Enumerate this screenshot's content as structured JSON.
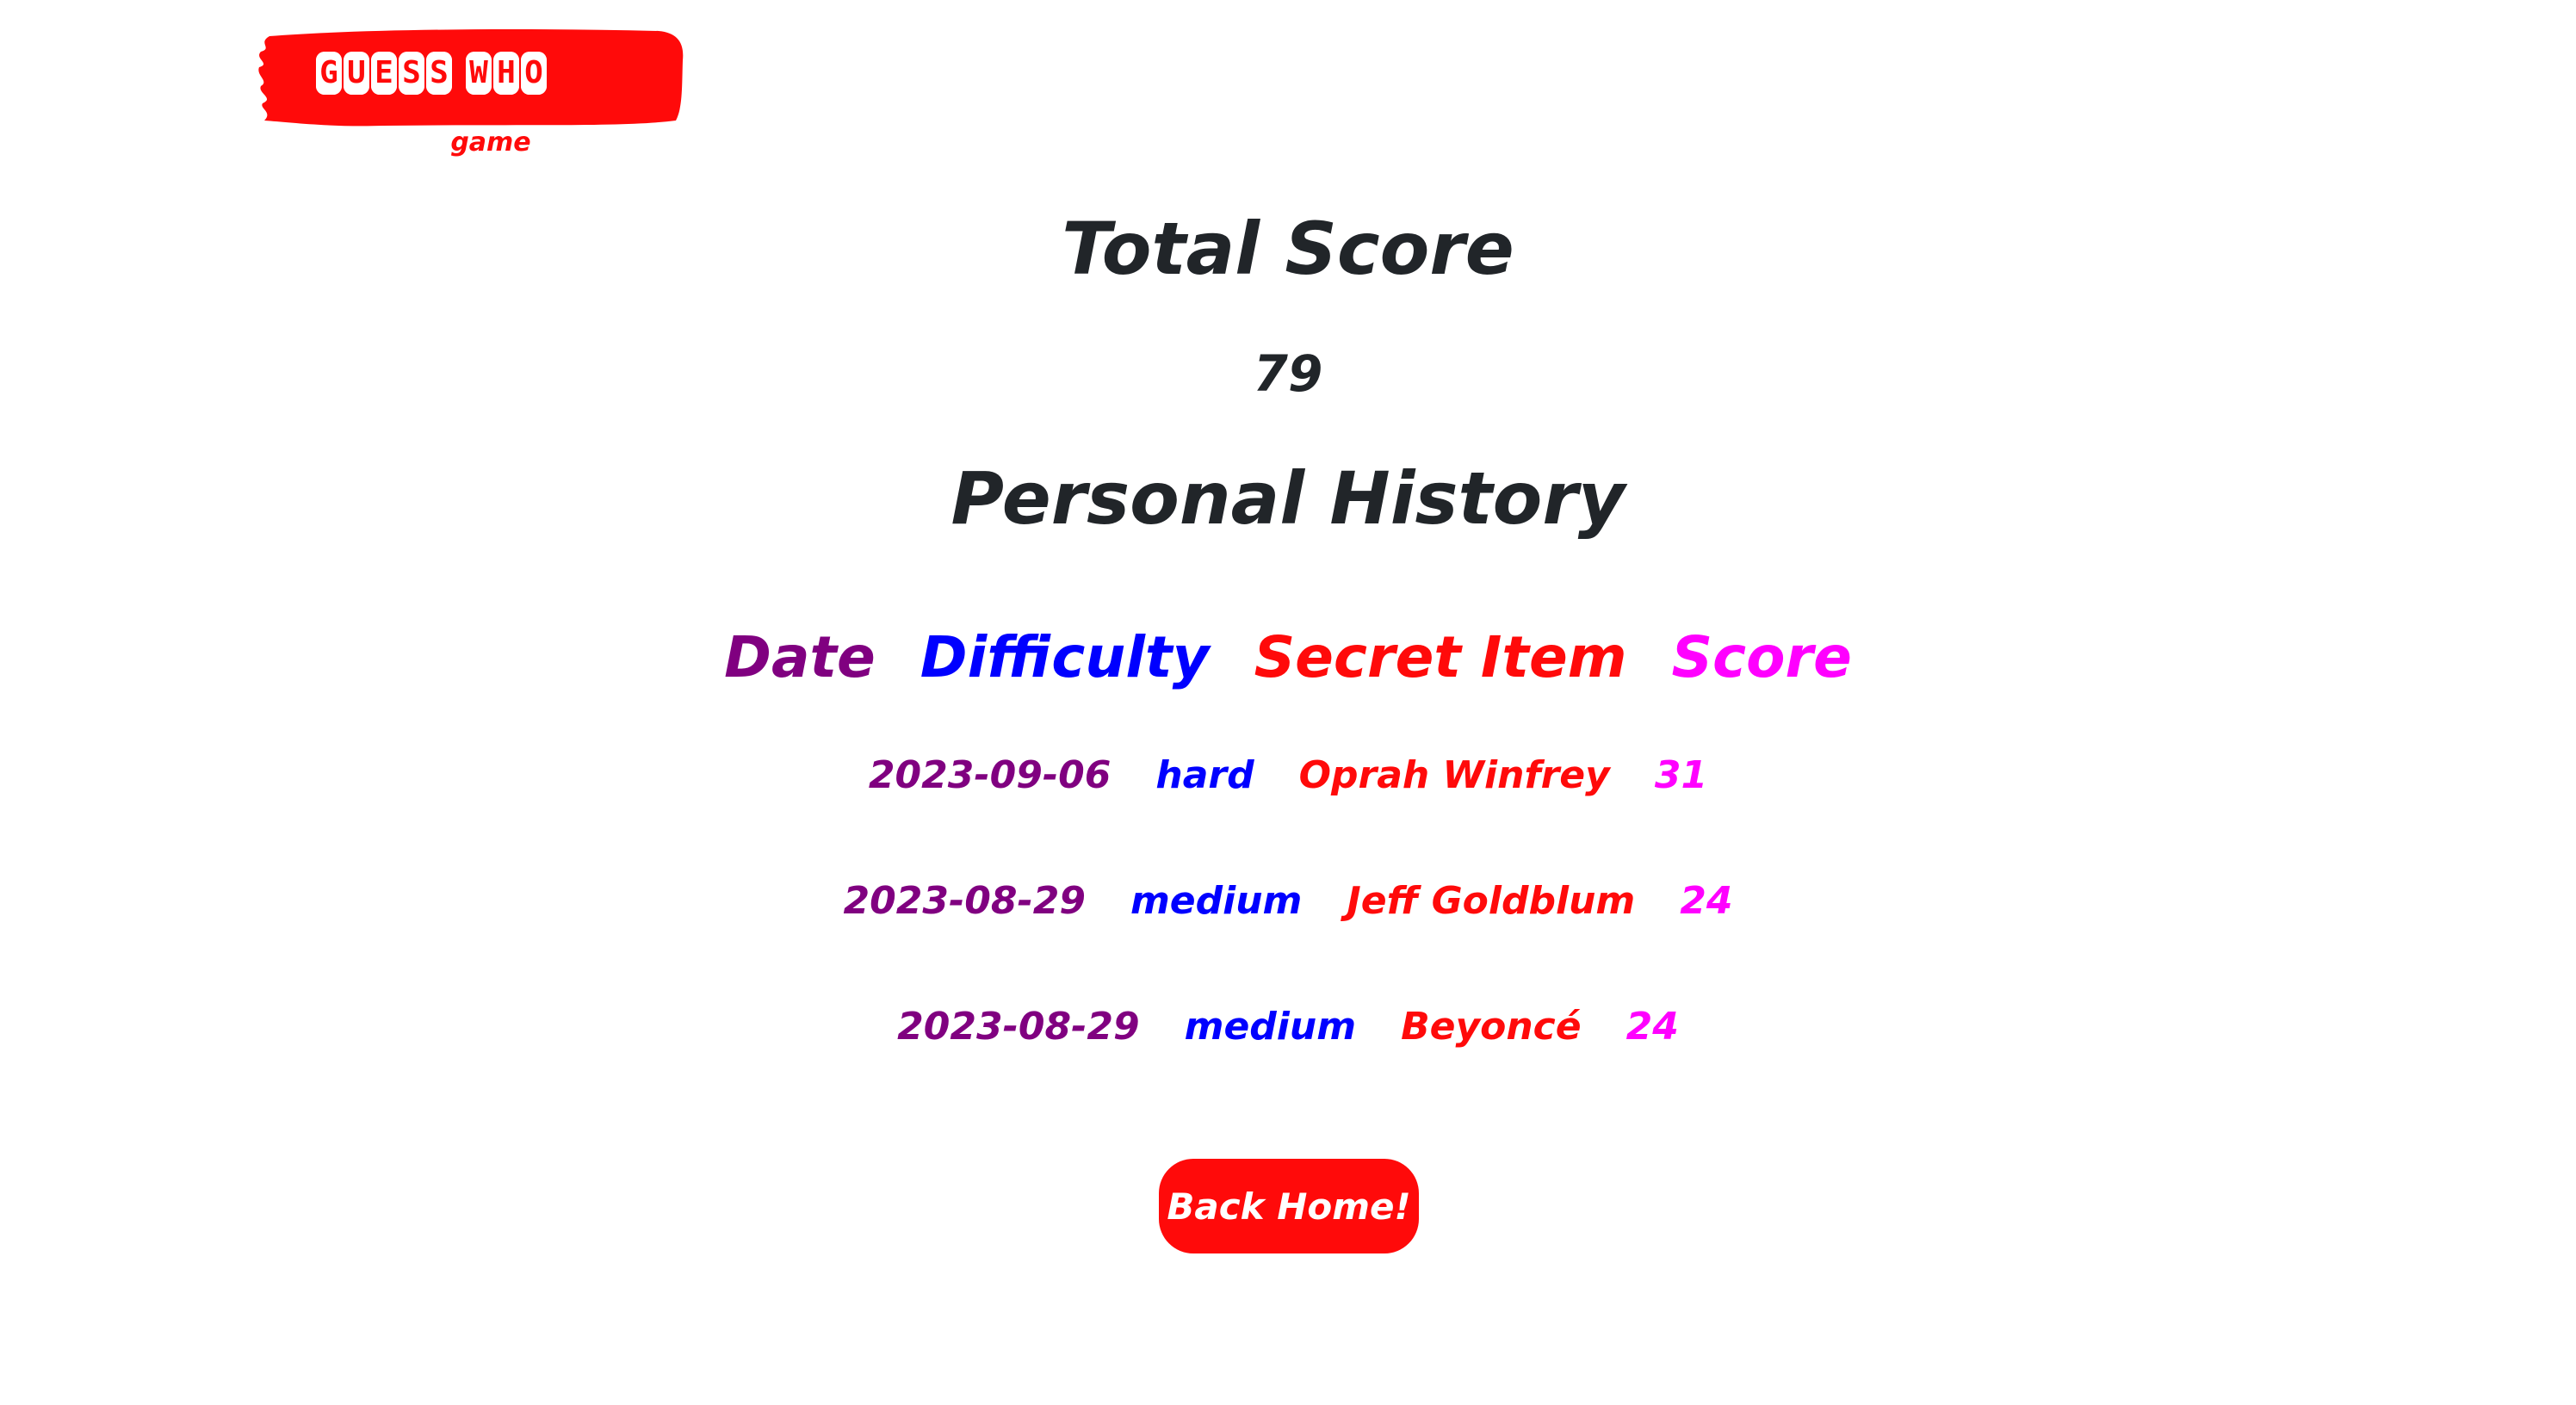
{
  "logo": {
    "title_letters": [
      "G",
      "U",
      "E",
      "S",
      "S"
    ],
    "title_letters_2": [
      "W",
      "H",
      "O"
    ],
    "subtitle": "game"
  },
  "score": {
    "title": "Total Score",
    "value": "79"
  },
  "history": {
    "title": "Personal History",
    "columns": {
      "date": "Date",
      "difficulty": "Difficulty",
      "item": "Secret Item",
      "score": "Score"
    },
    "rows": [
      {
        "date": "2023-09-06",
        "difficulty": "hard",
        "item": "Oprah Winfrey",
        "score": "31"
      },
      {
        "date": "2023-08-29",
        "difficulty": "medium",
        "item": "Jeff Goldblum",
        "score": "24"
      },
      {
        "date": "2023-08-29",
        "difficulty": "medium",
        "item": "Beyoncé",
        "score": "24"
      }
    ]
  },
  "actions": {
    "back_home_label": "Back Home!"
  },
  "colors": {
    "brand_red": "#ff0a0a",
    "date": "#800080",
    "difficulty": "#0000ff",
    "item": "#ff0a0a",
    "score": "#ff00ff",
    "text_dark": "#212529"
  }
}
